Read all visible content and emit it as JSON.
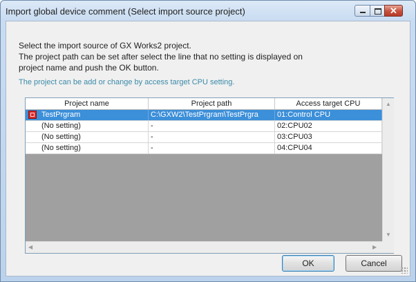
{
  "window": {
    "title": "Import global device comment (Select import source project)"
  },
  "description": {
    "line1": "Select the import source of GX Works2 project.",
    "line2": "The project path can be set after select the line that no setting is displayed on",
    "line3": "project name and push the OK button.",
    "note": "The project can be add or change by access target CPU setting."
  },
  "table": {
    "columns": [
      "Project name",
      "Project path",
      "Access target CPU"
    ],
    "rows": [
      {
        "project_name": "TestPrgram",
        "project_path": "C:\\GXW2\\TestPrgram\\TestPrgra",
        "cpu": "01:Control CPU",
        "selected": true,
        "icon": "gx-project-icon"
      },
      {
        "project_name": "(No setting)",
        "project_path": "-",
        "cpu": "02:CPU02",
        "selected": false
      },
      {
        "project_name": "(No setting)",
        "project_path": "-",
        "cpu": "03:CPU03",
        "selected": false
      },
      {
        "project_name": "(No setting)",
        "project_path": "-",
        "cpu": "04:CPU04",
        "selected": false
      }
    ]
  },
  "buttons": {
    "ok": "OK",
    "cancel": "Cancel"
  },
  "colors": {
    "selection": "#3c8fd9",
    "note": "#3a8aa8",
    "close": "#c7503c"
  },
  "icons": {
    "minimize": "minimize-icon",
    "maximize": "maximize-icon",
    "close": "close-icon"
  }
}
